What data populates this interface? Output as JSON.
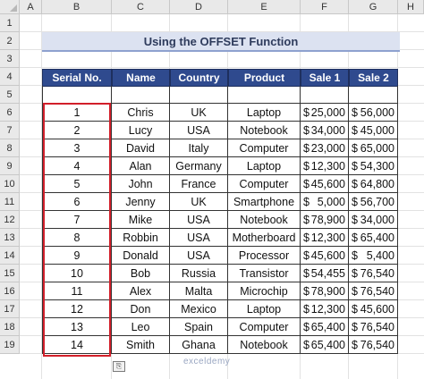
{
  "columns": [
    "A",
    "B",
    "C",
    "D",
    "E",
    "F",
    "G",
    "H"
  ],
  "rows": [
    "1",
    "2",
    "3",
    "4",
    "5",
    "6",
    "7",
    "8",
    "9",
    "10",
    "11",
    "12",
    "13",
    "14",
    "15",
    "16",
    "17",
    "18",
    "19"
  ],
  "title": "Using the OFFSET Function",
  "headers": [
    "Serial No.",
    "Name",
    "Country",
    "Product",
    "Sale 1",
    "Sale 2"
  ],
  "table": [
    [
      "1",
      "Chris",
      "UK",
      "Laptop",
      "25,000",
      "56,000"
    ],
    [
      "2",
      "Lucy",
      "USA",
      "Notebook",
      "34,000",
      "45,000"
    ],
    [
      "3",
      "David",
      "Italy",
      "Computer",
      "23,000",
      "65,000"
    ],
    [
      "4",
      "Alan",
      "Germany",
      "Laptop",
      "12,300",
      "54,300"
    ],
    [
      "5",
      "John",
      "France",
      "Computer",
      "45,600",
      "64,800"
    ],
    [
      "6",
      "Jenny",
      "UK",
      "Smartphone",
      "5,000",
      "56,700"
    ],
    [
      "7",
      "Mike",
      "USA",
      "Notebook",
      "78,900",
      "34,000"
    ],
    [
      "8",
      "Robbin",
      "USA",
      "Motherboard",
      "12,300",
      "65,400"
    ],
    [
      "9",
      "Donald",
      "USA",
      "Processor",
      "45,600",
      "5,400"
    ],
    [
      "10",
      "Bob",
      "Russia",
      "Transistor",
      "54,455",
      "76,540"
    ],
    [
      "11",
      "Alex",
      "Malta",
      "Microchip",
      "78,900",
      "76,540"
    ],
    [
      "12",
      "Don",
      "Mexico",
      "Laptop",
      "12,300",
      "45,600"
    ],
    [
      "13",
      "Leo",
      "Spain",
      "Computer",
      "65,400",
      "76,540"
    ],
    [
      "14",
      "Smith",
      "Ghana",
      "Notebook",
      "65,400",
      "76,540"
    ]
  ],
  "currency_symbol": "$",
  "watermark": "exceldemy",
  "colors": {
    "header_bg": "#2f4a8e",
    "title_bg": "#dce2f1",
    "highlight": "#d21f2a"
  },
  "icons": {
    "paste_options": "paste-options-icon"
  }
}
